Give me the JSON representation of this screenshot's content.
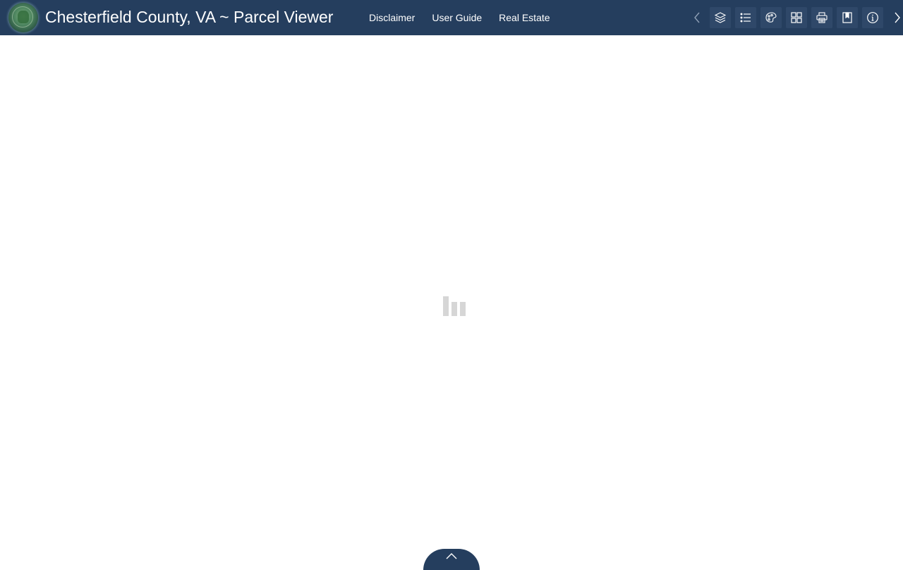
{
  "app": {
    "title": "Chesterfield County, VA ~ Parcel Viewer",
    "logo_icon": "county-seal-logo",
    "header_color": "#253e5e"
  },
  "nav": {
    "links": [
      {
        "label": "Disclaimer"
      },
      {
        "label": "User Guide"
      },
      {
        "label": "Real Estate"
      }
    ]
  },
  "toolbar": {
    "prev_icon": "chevron-left-icon",
    "next_icon": "chevron-right-icon",
    "buttons": [
      {
        "icon": "layers-icon"
      },
      {
        "icon": "legend-list-icon"
      },
      {
        "icon": "basemap-gallery-icon"
      },
      {
        "icon": "widget-grid-icon"
      },
      {
        "icon": "print-icon"
      },
      {
        "icon": "bookmark-icon"
      },
      {
        "icon": "info-icon"
      }
    ]
  },
  "map": {
    "loading_indicator": "loading-bars-icon",
    "loader_color": "#d6d6d6"
  },
  "bottom_panel": {
    "toggle_icon": "chevron-up-icon"
  }
}
